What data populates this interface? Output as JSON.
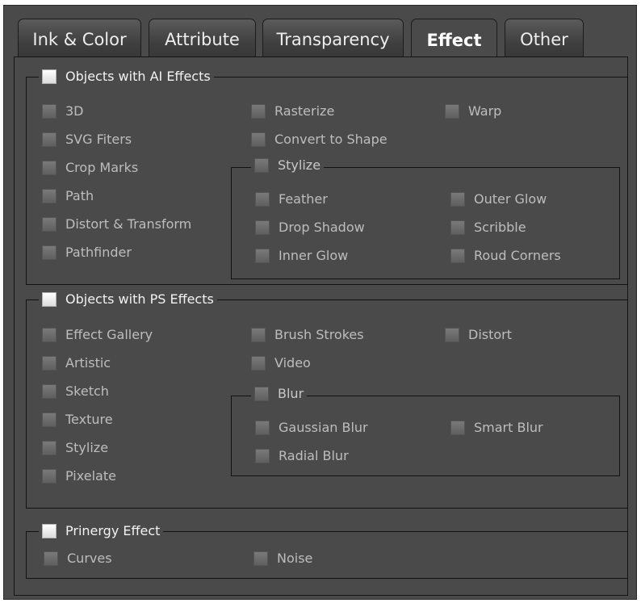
{
  "tabs": [
    "Ink & Color",
    "Attribute",
    "Transparency",
    "Effect",
    "Other"
  ],
  "active_tab": "Effect",
  "ai_section": {
    "title": "Objects with AI Effects",
    "col1": [
      "3D",
      "SVG Fiters",
      "Crop Marks",
      "Path",
      "Distort & Transform",
      "Pathfinder"
    ],
    "col2": [
      "Rasterize",
      "Convert to Shape"
    ],
    "col3": [
      "Warp"
    ],
    "stylize": {
      "title": "Stylize",
      "left": [
        "Feather",
        "Drop Shadow",
        "Inner Glow"
      ],
      "right": [
        "Outer Glow",
        "Scribble",
        "Roud Corners"
      ]
    }
  },
  "ps_section": {
    "title": "Objects with PS Effects",
    "col1": [
      "Effect Gallery",
      "Artistic",
      "Sketch",
      "Texture",
      "Stylize",
      "Pixelate"
    ],
    "col2": [
      "Brush Strokes",
      "Video"
    ],
    "col3": [
      "Distort"
    ],
    "blur": {
      "title": "Blur",
      "left": [
        "Gaussian Blur",
        "Radial Blur"
      ],
      "right": [
        "Smart Blur"
      ]
    }
  },
  "prinergy_section": {
    "title": "Prinergy Effect",
    "items": [
      "Curves",
      "Noise"
    ]
  }
}
